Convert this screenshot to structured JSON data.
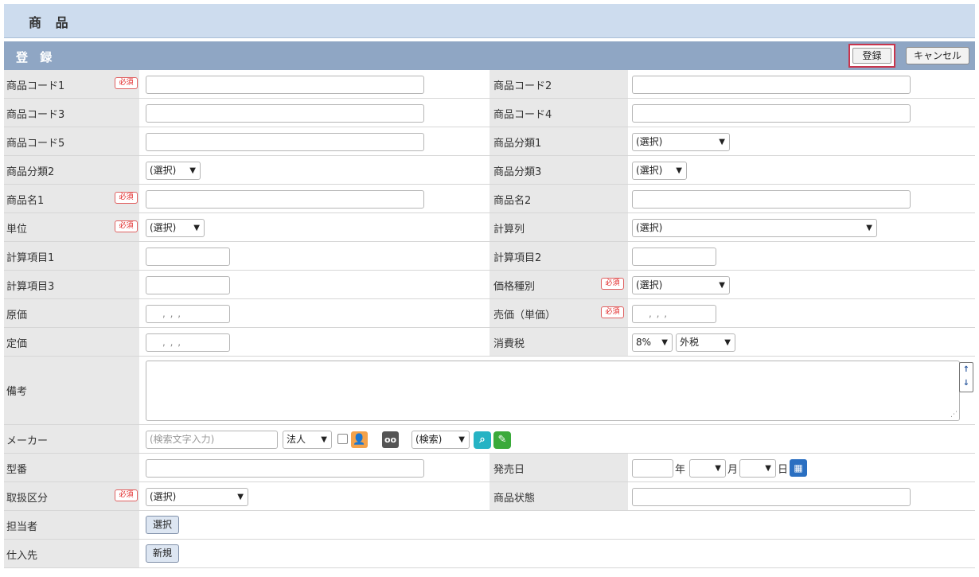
{
  "header": {
    "title": "商 品"
  },
  "section": {
    "title": "登 録",
    "register_label": "登録",
    "cancel_label": "キャンセル"
  },
  "required_label": "必須",
  "fields": {
    "code1": {
      "label": "商品コード1"
    },
    "code2": {
      "label": "商品コード2"
    },
    "code3": {
      "label": "商品コード3"
    },
    "code4": {
      "label": "商品コード4"
    },
    "code5": {
      "label": "商品コード5"
    },
    "category1": {
      "label": "商品分類1",
      "value": "(選択)"
    },
    "category2": {
      "label": "商品分類2",
      "value": "(選択)"
    },
    "category3": {
      "label": "商品分類3",
      "value": "(選択)"
    },
    "name1": {
      "label": "商品名1"
    },
    "name2": {
      "label": "商品名2"
    },
    "unit": {
      "label": "単位",
      "value": "(選択)"
    },
    "calc_column": {
      "label": "計算列",
      "value": "(選択)"
    },
    "calc_item1": {
      "label": "計算項目1"
    },
    "calc_item2": {
      "label": "計算項目2"
    },
    "calc_item3": {
      "label": "計算項目3"
    },
    "price_type": {
      "label": "価格種別",
      "value": "(選択)"
    },
    "cost": {
      "label": "原価",
      "value": ", , ,"
    },
    "sell_price": {
      "label": "売価（単価）",
      "value": ", , ,"
    },
    "list_price": {
      "label": "定価",
      "value": ", , ,"
    },
    "tax": {
      "label": "消費税",
      "rate": "8%",
      "type": "外税"
    },
    "remarks": {
      "label": "備考"
    },
    "maker": {
      "label": "メーカー",
      "placeholder": "(検索文字入力)",
      "corp_type": "法人",
      "search_select": "(検索)"
    },
    "model": {
      "label": "型番"
    },
    "release_date": {
      "label": "発売日",
      "year_unit": "年",
      "month_unit": "月",
      "day_unit": "日"
    },
    "handling": {
      "label": "取扱区分",
      "value": "(選択)"
    },
    "status": {
      "label": "商品状態"
    },
    "staff": {
      "label": "担当者",
      "button": "選択"
    },
    "supplier": {
      "label": "仕入先",
      "button": "新規"
    }
  },
  "icons": {
    "dropdown": "▼",
    "resize_up": "↑",
    "resize_down": "↓",
    "grip": "⋰",
    "person": "👤",
    "binoculars": "oo",
    "search": "⌕",
    "pencil": "✎",
    "calendar": "▦"
  }
}
